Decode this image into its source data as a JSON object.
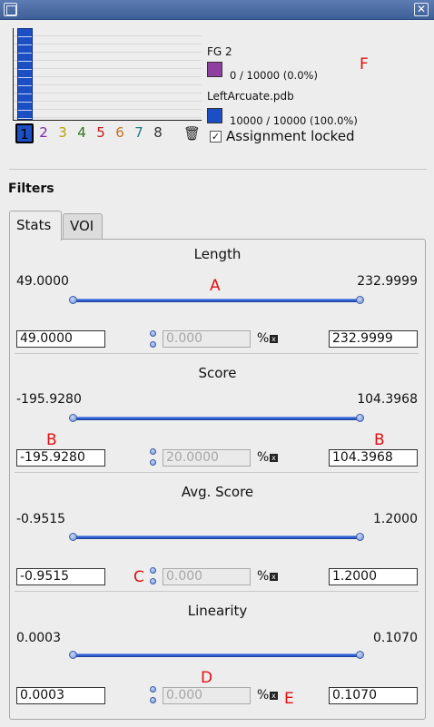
{
  "window": {
    "close_glyph": "✕"
  },
  "histogram": {
    "bar_fill_ratio": 1.0,
    "groups": [
      {
        "label": "1",
        "color": "#1c4fc4",
        "active": true
      },
      {
        "label": "2",
        "color": "#7a2aa8",
        "active": false
      },
      {
        "label": "3",
        "color": "#b8a400",
        "active": false
      },
      {
        "label": "4",
        "color": "#2b7a1a",
        "active": false
      },
      {
        "label": "5",
        "color": "#c41c1c",
        "active": false
      },
      {
        "label": "6",
        "color": "#c4731c",
        "active": false
      },
      {
        "label": "7",
        "color": "#1c7a8a",
        "active": false
      },
      {
        "label": "8",
        "color": "#333333",
        "active": false
      }
    ],
    "trash_icon": "trash-icon"
  },
  "legend": {
    "fg_name": "FG 2",
    "fg_color": "#8f3f9f",
    "fg_count": "0 / 10000 (0.0%)",
    "file_name": "LeftArcuate.pdb",
    "file_color": "#1c4fc4",
    "file_count": "10000 / 10000 (100.0%)",
    "assignment_locked": true,
    "assignment_label": "Assignment locked"
  },
  "annotations": {
    "F": "F",
    "A": "A",
    "B1": "B",
    "B2": "B",
    "C": "C",
    "D": "D",
    "E": "E"
  },
  "filters": {
    "title": "Filters",
    "tabs": [
      {
        "label": "Stats"
      },
      {
        "label": "VOI"
      }
    ],
    "sections": [
      {
        "title": "Length",
        "min": "49.0000",
        "max": "232.9999",
        "low": "49.0000",
        "high": "232.9999",
        "percent": "0.000"
      },
      {
        "title": "Score",
        "min": "-195.9280",
        "max": "104.3968",
        "low": "-195.9280",
        "high": "104.3968",
        "percent": "20.0000"
      },
      {
        "title": "Avg. Score",
        "min": "-0.9515",
        "max": "1.2000",
        "low": "-0.9515",
        "high": "1.2000",
        "percent": "0.000"
      },
      {
        "title": "Linearity",
        "min": "0.0003",
        "max": "0.1070",
        "low": "0.0003",
        "high": "0.1070",
        "percent": "0.000"
      }
    ],
    "percent_symbol": "%"
  }
}
